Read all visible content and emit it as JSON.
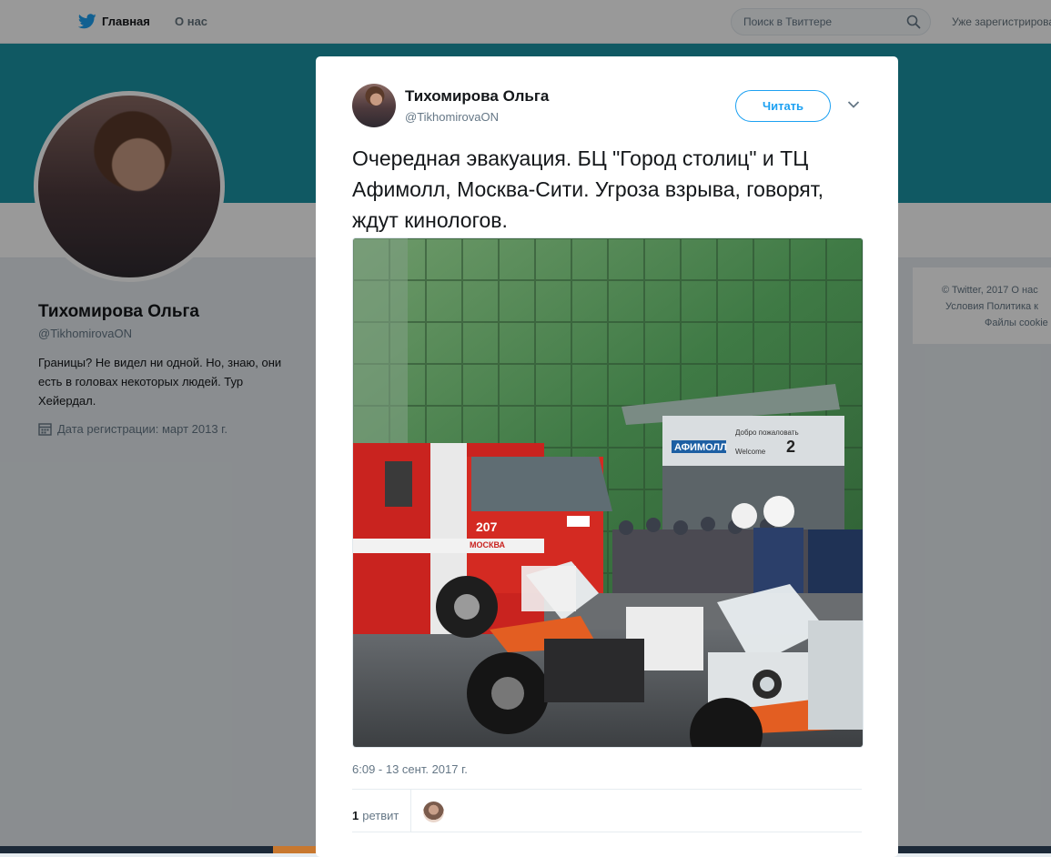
{
  "nav": {
    "home_label": "Главная",
    "about_label": "О нас",
    "search_placeholder": "Поиск в Твиттере",
    "login_text": "Уже зарегистрирова"
  },
  "profile": {
    "name": "Тихомирова Ольга",
    "handle": "@TikhomirovaON",
    "bio": "Границы? Не видел ни одной. Но, знаю, они есть в головах некоторых людей. Тур Хейердал.",
    "joined": "Дата регистрации: март 2013 г."
  },
  "footer": {
    "line1": "© Twitter, 2017    О нас",
    "line2": "Условия    Политика к",
    "line3": "Файлы cookie"
  },
  "tweet": {
    "author_name": "Тихомирова Ольга",
    "author_handle": "@TikhomirovaON",
    "follow_label": "Читать",
    "text": "Очередная эвакуация. БЦ \"Город столиц\" и ТЦ Афимолл, Москва-Сити. Угроза взрыва, говорят, ждут кинологов.",
    "timestamp": "6:09 - 13 сент. 2017 г.",
    "retweet_count": "1",
    "retweet_label": "ретвит",
    "photo": {
      "sign_brand": "АФИМОЛЛ",
      "sign_welcome_ru": "Добро пожаловать",
      "sign_welcome_en": "Welcome",
      "sign_floor": "2",
      "truck_number": "207",
      "truck_city": "МОСКВА"
    }
  },
  "colors": {
    "brand_blue": "#1da1f2",
    "banner": "#1b95a6"
  }
}
